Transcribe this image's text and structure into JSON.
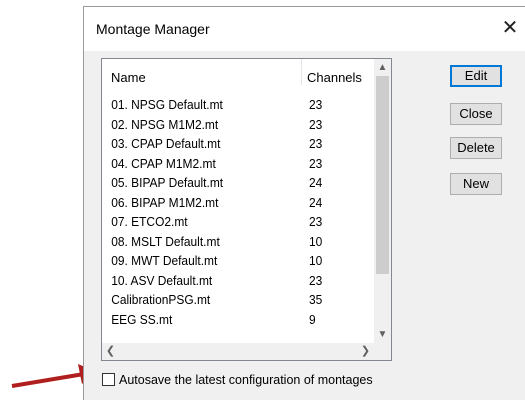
{
  "window": {
    "title": "Montage Manager",
    "close_glyph": "✕"
  },
  "list": {
    "headers": {
      "name": "Name",
      "channels": "Channels"
    },
    "rows": [
      {
        "name": "01. NPSG Default.mt",
        "channels": "23"
      },
      {
        "name": "02. NPSG M1M2.mt",
        "channels": "23"
      },
      {
        "name": "03. CPAP Default.mt",
        "channels": "23"
      },
      {
        "name": "04. CPAP M1M2.mt",
        "channels": "23"
      },
      {
        "name": "05. BIPAP Default.mt",
        "channels": "24"
      },
      {
        "name": "06. BIPAP M1M2.mt",
        "channels": "24"
      },
      {
        "name": "07. ETCO2.mt",
        "channels": "23"
      },
      {
        "name": "08. MSLT Default.mt",
        "channels": "10"
      },
      {
        "name": "09. MWT Default.mt",
        "channels": "10"
      },
      {
        "name": "10. ASV Default.mt",
        "channels": "23"
      },
      {
        "name": "CalibrationPSG.mt",
        "channels": "35"
      },
      {
        "name": "EEG SS.mt",
        "channels": "9"
      }
    ]
  },
  "buttons": {
    "edit": "Edit",
    "close": "Close",
    "delete": "Delete",
    "new": "New"
  },
  "autosave": {
    "label": "Autosave the latest configuration of montages",
    "checked": false
  },
  "colors": {
    "annotation_arrow": "#b01e1e",
    "default_button_border": "#0078d7"
  },
  "icons": {
    "scroll_up": "chevron-up-icon",
    "scroll_down": "chevron-down-icon",
    "scroll_left": "chevron-left-icon",
    "scroll_right": "chevron-right-icon"
  }
}
